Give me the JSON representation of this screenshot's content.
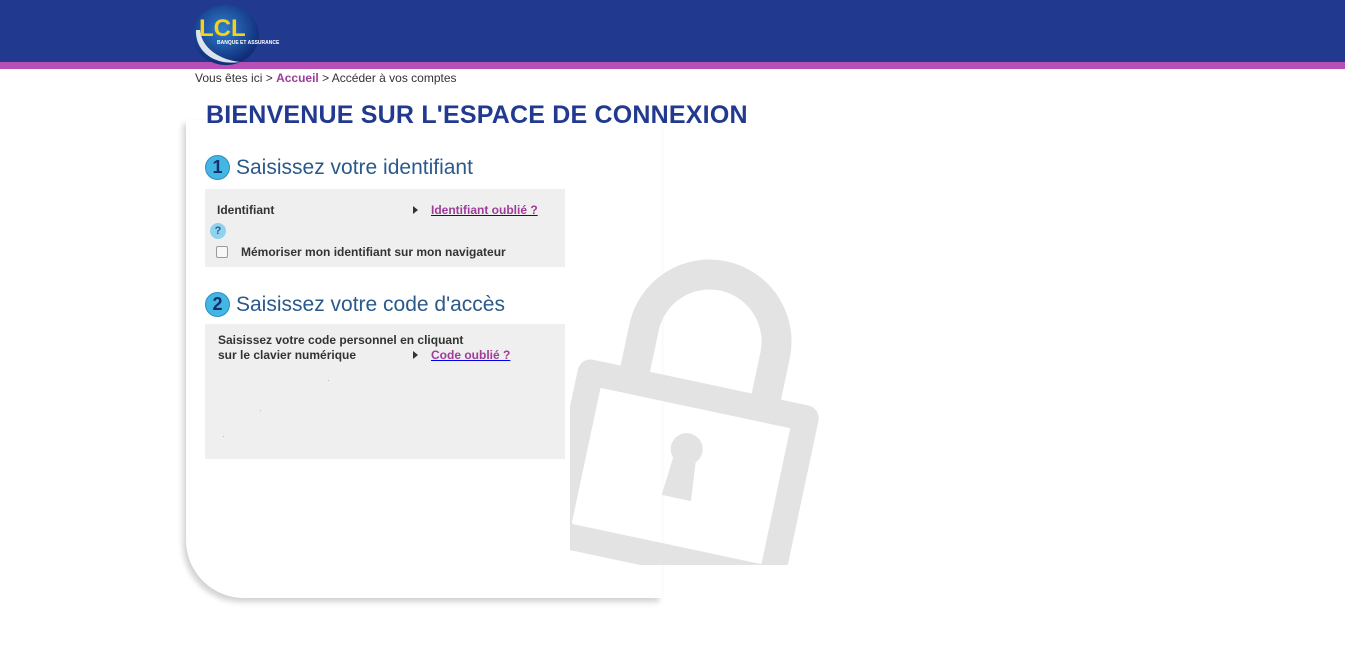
{
  "brand": {
    "logo_text": "LCL",
    "logo_subtitle": "BANQUE ET ASSURANCE",
    "colors": {
      "header": "#213a8f",
      "stripe": "#b84fb7",
      "accent": "#9e3c9a",
      "badge": "#44b6e4"
    }
  },
  "breadcrumb": {
    "prefix": "Vous êtes ici",
    "separator": ">",
    "home": "Accueil",
    "current": "Accéder à vos comptes"
  },
  "page_title": "BIENVENUE SUR L'ESPACE DE CONNEXION",
  "step1": {
    "number": "1",
    "title": "Saisissez votre identifiant",
    "field_label": "Identifiant",
    "forgot_link": "Identifiant oublié ?",
    "help_icon": "question-mark-icon",
    "help_symbol": "?",
    "remember_label": "Mémoriser mon identifiant sur mon navigateur",
    "remember_checked": false
  },
  "step2": {
    "number": "2",
    "title": "Saisissez votre code d'accès",
    "instructions_line1": "Saisissez votre code personnel en cliquant",
    "instructions_line2": "sur le clavier numérique",
    "forgot_link": "Code oublié ?"
  },
  "icons": {
    "arrow": "triangle-right-icon",
    "background": "padlock-icon"
  }
}
